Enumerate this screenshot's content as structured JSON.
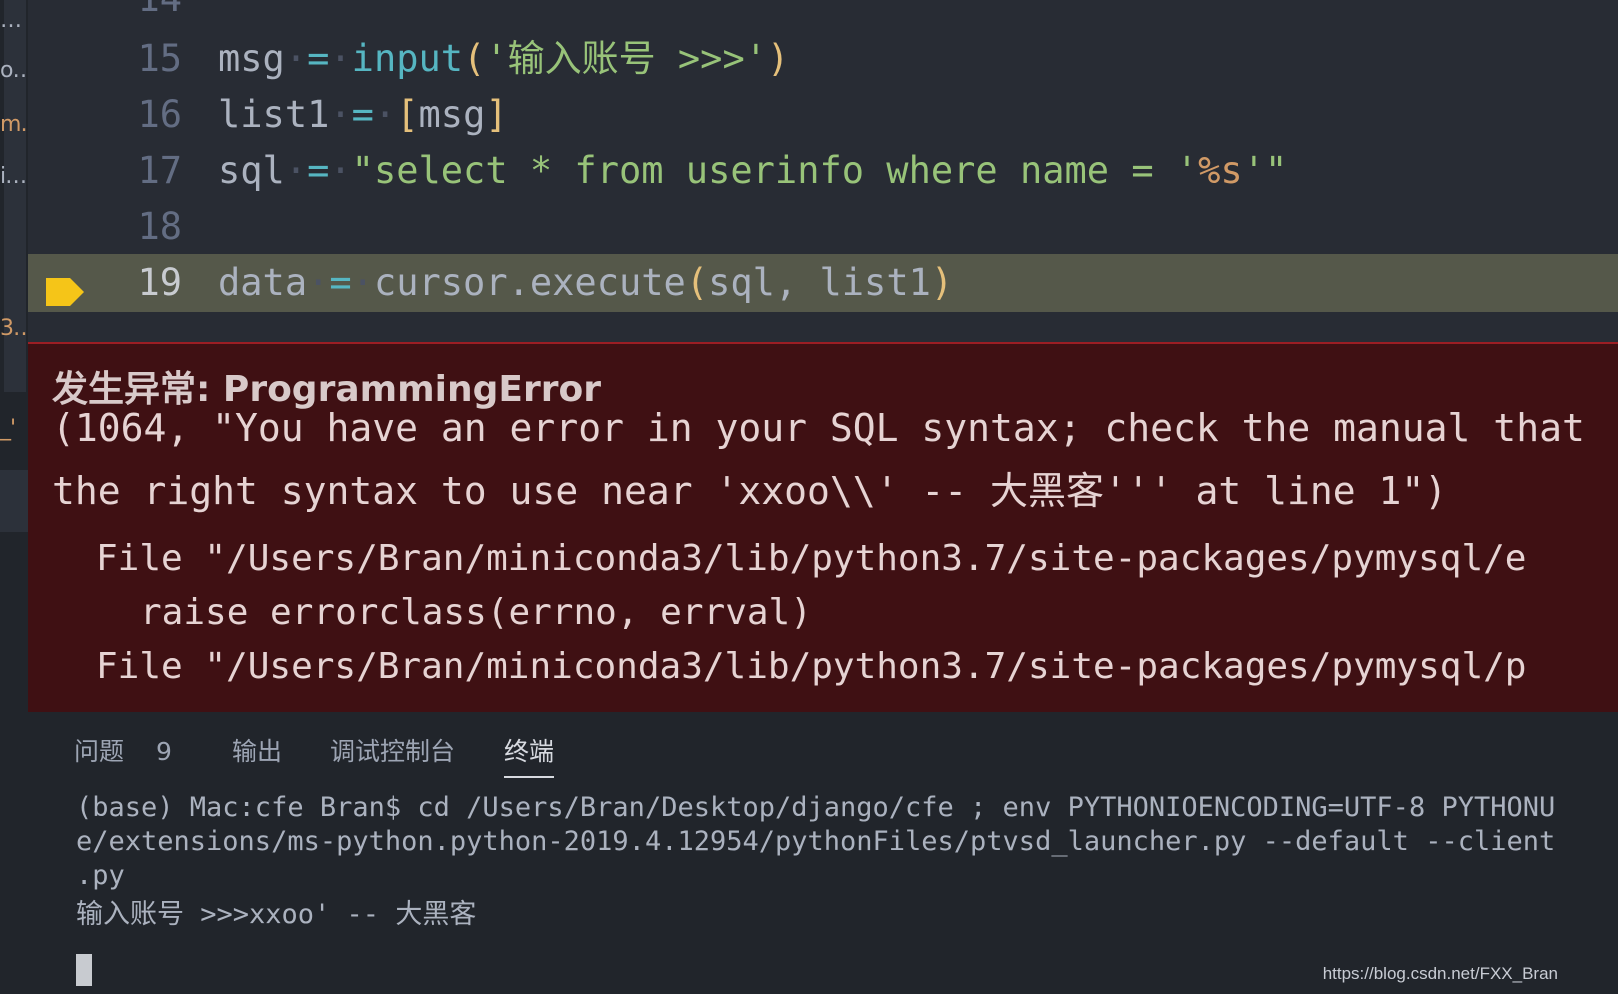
{
  "sidebar": {
    "items": [
      {
        "label": "…",
        "color": "#abb2bf"
      },
      {
        "label": "o…",
        "color": "#abb2bf"
      },
      {
        "label": "m…",
        "color": "#d19a66"
      },
      {
        "label": "i…",
        "color": "#abb2bf"
      },
      {
        "label": "3…",
        "color": "#d19a66"
      },
      {
        "label": "_'",
        "color": "#d19a66"
      }
    ]
  },
  "editor": {
    "partial_line_number": "14",
    "lines": [
      {
        "number": "15",
        "tokens": {
          "a": "msg",
          "b": "=",
          "c": "input",
          "d": "(",
          "e": "'输入账号 >>>'",
          "f": ")"
        }
      },
      {
        "number": "16",
        "tokens": {
          "a": "list1",
          "b": "=",
          "c": "[",
          "d": "msg",
          "e": "]"
        }
      },
      {
        "number": "17",
        "tokens": {
          "a": "sql",
          "b": "=",
          "c": "\"select * from userinfo where name = '",
          "d": "%s",
          "e": "'\""
        }
      },
      {
        "number": "18"
      },
      {
        "number": "19",
        "tokens": {
          "a": "data",
          "b": "=",
          "c": "cursor.execute",
          "d": "(",
          "e": "sql, list1",
          "f": ")"
        }
      }
    ]
  },
  "exception": {
    "title": "发生异常: ProgrammingError",
    "message_line1": "(1064, \"You have an error in your SQL syntax; check the manual that",
    "message_line2": "the right syntax to use near 'xxoo\\\\' -- 大黑客''' at line 1\")",
    "traceback": [
      "File \"/Users/Bran/miniconda3/lib/python3.7/site-packages/pymysql/e",
      "raise errorclass(errno, errval)",
      "File \"/Users/Bran/miniconda3/lib/python3.7/site-packages/pymysql/p"
    ]
  },
  "panel": {
    "tabs": [
      {
        "label": "问题",
        "count": "9"
      },
      {
        "label": "输出"
      },
      {
        "label": "调试控制台"
      },
      {
        "label": "终端"
      }
    ],
    "active_tab": "终端",
    "terminal_lines": [
      "(base) Mac:cfe Bran$ cd /Users/Bran/Desktop/django/cfe ; env PYTHONIOENCODING=UTF-8 PYTHONU",
      "e/extensions/ms-python.python-2019.4.12954/pythonFiles/ptvsd_launcher.py --default --client",
      ".py",
      "输入账号 >>>xxoo' -- 大黑客"
    ]
  },
  "watermark": "https://blog.csdn.net/FXX_Bran",
  "colors": {
    "editor_bg": "#282c34",
    "current_line": "#55584a",
    "exception_bg": "#3f1013",
    "breakpoint_arrow": "#f5c518"
  }
}
